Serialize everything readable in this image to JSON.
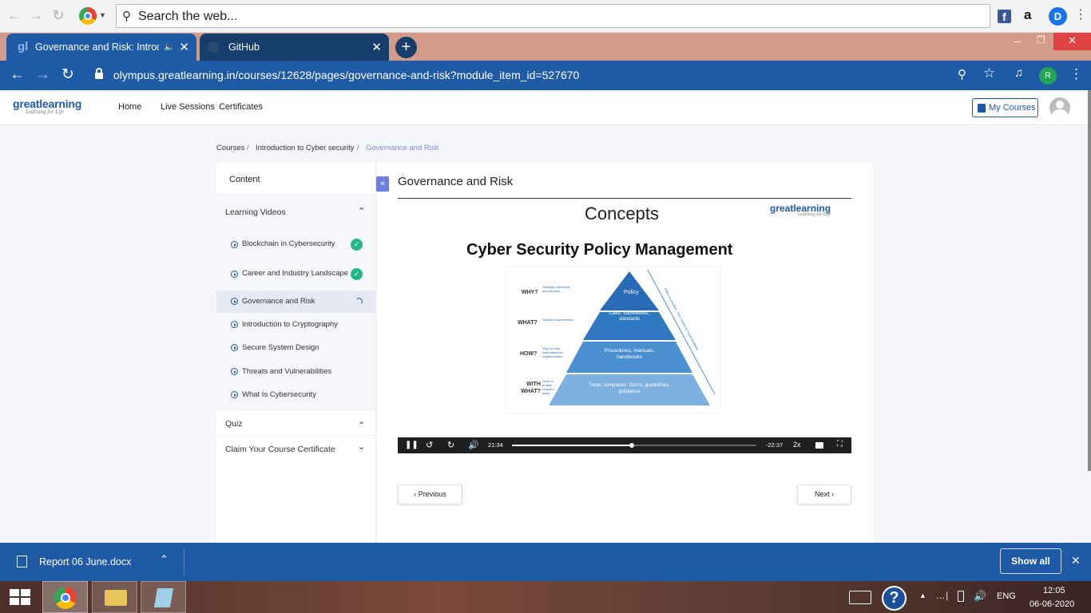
{
  "browser": {
    "search_placeholder": "Search the web...",
    "tabs": [
      {
        "title": "Governance and Risk: Introdu",
        "icon": "greatlearning-favicon"
      },
      {
        "title": "GitHub",
        "icon": "github-icon"
      }
    ],
    "url": "olympus.greatlearning.in/courses/12628/pages/governance-and-risk?module_item_id=527670",
    "profile_initial": "R"
  },
  "site": {
    "logo_main": "greatlearning",
    "logo_tag": "Learning for Life",
    "nav": [
      "Home",
      "Live Sessions",
      "Certificates"
    ],
    "my_courses": "My Courses"
  },
  "breadcrumb": [
    "Courses",
    "Introduction to Cyber security",
    "Governance and Risk"
  ],
  "sidebar": {
    "content_label": "Content",
    "sections": [
      {
        "label": "Learning Videos"
      },
      {
        "label": "Quiz"
      },
      {
        "label": "Claim Your Course Certificate"
      }
    ],
    "items": [
      {
        "label": "Blockchain in Cybersecurity",
        "status": "completed"
      },
      {
        "label": "Career and Industry Landscape",
        "status": "completed"
      },
      {
        "label": "Governance and Risk",
        "status": "in-progress"
      },
      {
        "label": "Introduction to Cryptography",
        "status": ""
      },
      {
        "label": "Secure System Design",
        "status": ""
      },
      {
        "label": "Threats and Vulnerabilities",
        "status": ""
      },
      {
        "label": "What Is Cybersecurity",
        "status": ""
      }
    ]
  },
  "main": {
    "title": "Governance and Risk",
    "video": {
      "slide_heading": "Concepts",
      "slide_title": "Cyber Security Policy Management",
      "logo_main": "greatlearning",
      "logo_tag": "Learning for Life",
      "pyramid": {
        "left_labels": [
          "WHY?",
          "WHAT?",
          "HOW?",
          "WITH WHAT?"
        ],
        "left_notes": [
          "Strategic objectives and purpose",
          "Specific requirements",
          "Step by step instructions for required tasks",
          "Tools to enable required tasks"
        ],
        "levels": [
          "Policy",
          "Laws, frameworks, standards",
          "Procedures, manuals, handbooks",
          "Tools, templates, forms, guidelines, guidance"
        ],
        "right_notes": [
          "Top Policy",
          "Policy to practice - from control to implementation"
        ]
      },
      "elapsed": "21:34",
      "remaining": "-22:37",
      "speed": "2x",
      "progress": 0.49
    },
    "previous": "Previous",
    "next": "Next"
  },
  "downloads": {
    "file": "Report 06 June.docx",
    "show_all": "Show all"
  },
  "taskbar": {
    "lang": "ENG",
    "time": "12:05",
    "date": "06-06-2020"
  },
  "colors": {
    "browser_blue": "#1f5aa7",
    "tabstrip": "#d49c88",
    "complete_green": "#23b58c",
    "accent_purple": "#6c7fe0"
  }
}
